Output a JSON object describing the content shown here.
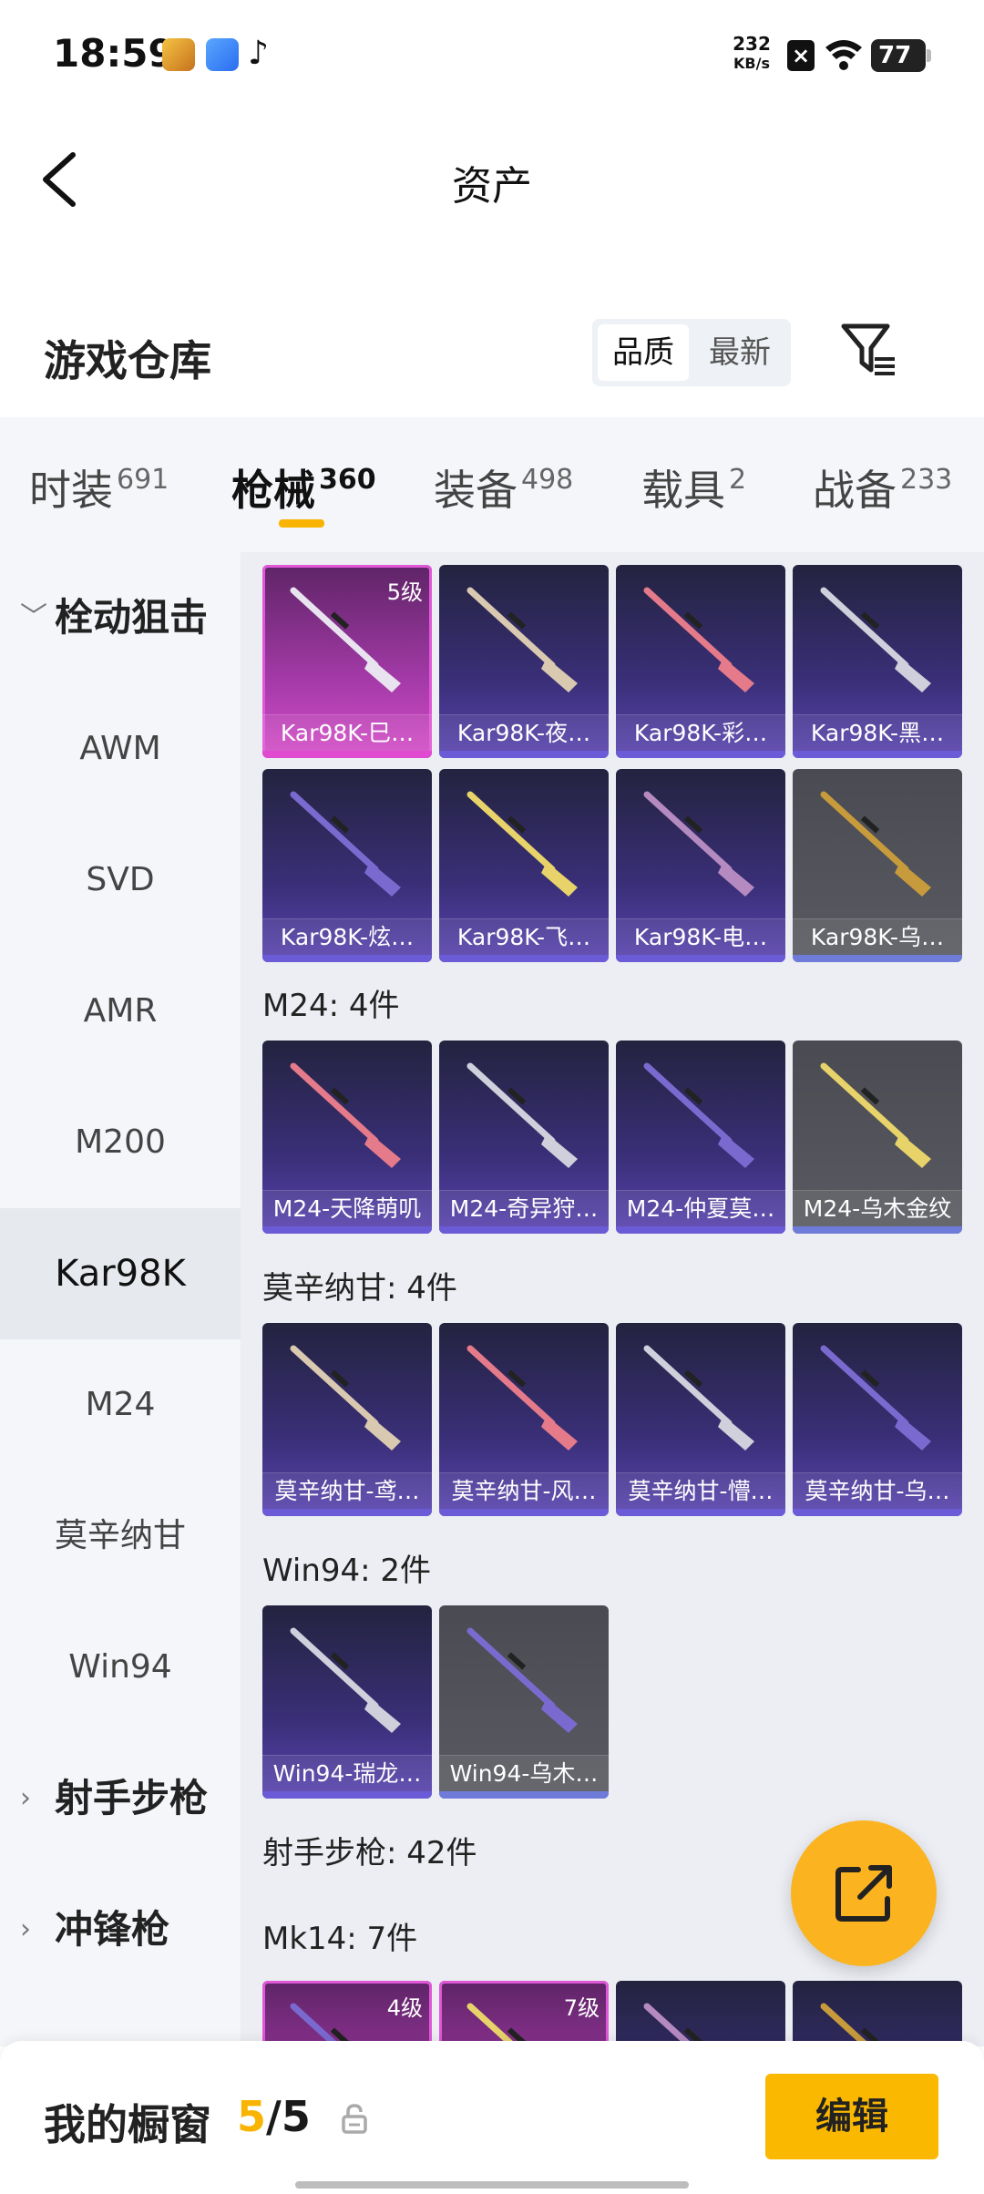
{
  "status": {
    "time": "18:59",
    "net_speed_value": "232",
    "net_speed_unit": "KB/s",
    "battery": "77"
  },
  "header": {
    "title": "资产"
  },
  "section": {
    "title": "游戏仓库",
    "sort_quality": "品质",
    "sort_newest": "最新"
  },
  "tabs": [
    {
      "label": "时装",
      "count": "691"
    },
    {
      "label": "枪械",
      "count": "360"
    },
    {
      "label": "装备",
      "count": "498"
    },
    {
      "label": "载具",
      "count": "2"
    },
    {
      "label": "战备",
      "count": "233"
    }
  ],
  "sidebar": {
    "group_sniper": "栓动狙击",
    "items": [
      "AWM",
      "SVD",
      "AMR",
      "M200",
      "Kar98K",
      "M24",
      "莫辛纳甘",
      "Win94"
    ],
    "group_marksman": "射手步枪",
    "group_smg": "冲锋枪"
  },
  "grid": {
    "kar98k": [
      {
        "label": "Kar98K-巳…",
        "level": "5级",
        "tier": "pink"
      },
      {
        "label": "Kar98K-夜…",
        "tier": "purple"
      },
      {
        "label": "Kar98K-彩…",
        "tier": "purple"
      },
      {
        "label": "Kar98K-黑…",
        "tier": "purple"
      },
      {
        "label": "Kar98K-炫…",
        "tier": "purple"
      },
      {
        "label": "Kar98K-飞…",
        "tier": "purple"
      },
      {
        "label": "Kar98K-电…",
        "tier": "purple"
      },
      {
        "label": "Kar98K-乌…",
        "tier": "gray"
      }
    ],
    "m24_header": "M24: 4件",
    "m24": [
      {
        "label": "M24-天降萌叽",
        "tier": "purple"
      },
      {
        "label": "M24-奇异狩…",
        "tier": "purple"
      },
      {
        "label": "M24-仲夏莫…",
        "tier": "purple"
      },
      {
        "label": "M24-乌木金纹",
        "tier": "gray"
      }
    ],
    "mosin_header": "莫辛纳甘: 4件",
    "mosin": [
      {
        "label": "莫辛纳甘-鸢…",
        "tier": "purple"
      },
      {
        "label": "莫辛纳甘-风…",
        "tier": "purple"
      },
      {
        "label": "莫辛纳甘-懵…",
        "tier": "purple"
      },
      {
        "label": "莫辛纳甘-乌…",
        "tier": "purple"
      }
    ],
    "win94_header": "Win94: 2件",
    "win94": [
      {
        "label": "Win94-瑞龙…",
        "tier": "purple"
      },
      {
        "label": "Win94-乌木…",
        "tier": "gray"
      }
    ],
    "marksman_header": "射手步枪: 42件",
    "mk14_header": "Mk14: 7件",
    "mk14": [
      {
        "level": "4级",
        "tier": "pink"
      },
      {
        "level": "7级",
        "tier": "pink"
      },
      {
        "tier": "purple"
      },
      {
        "tier": "purple"
      }
    ]
  },
  "bottom": {
    "window_label": "我的橱窗",
    "window_current": "5",
    "window_sep": "/",
    "window_total": "5",
    "edit": "编辑"
  },
  "colors": {
    "accent": "#f8b400",
    "card_purple": "#3a2f78",
    "card_pink": "#a43aa8",
    "card_gray": "#55565d"
  }
}
